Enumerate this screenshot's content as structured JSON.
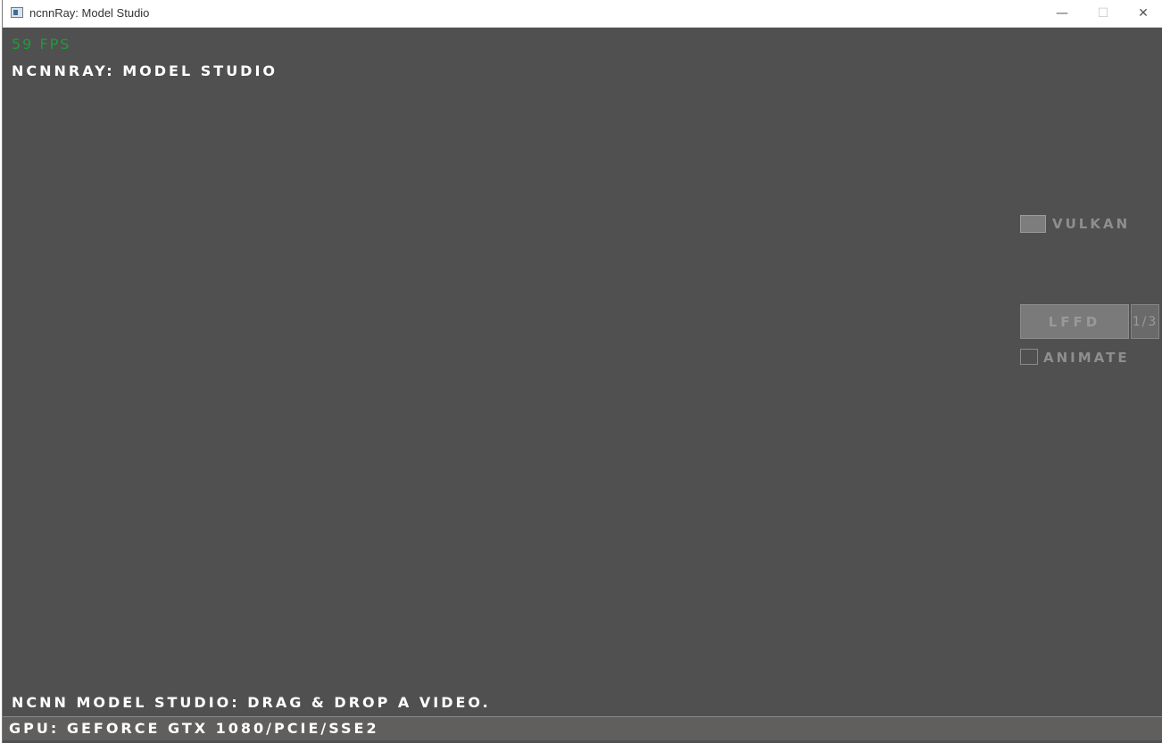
{
  "window": {
    "title": "ncnnRay: Model Studio",
    "minimize_glyph": "—",
    "maximize_glyph": "☐",
    "close_glyph": "✕"
  },
  "hud": {
    "fps": "59 FPS",
    "heading": "ncnnRay: Model Studio"
  },
  "controls": {
    "vulkan_label": "Vulkan",
    "vulkan_checked": true,
    "model_name": "LFFD",
    "model_counter": "1/3",
    "animate_label": "Animate",
    "animate_checked": false
  },
  "status": {
    "message": "NCNN Model Studio: Drag & Drop a video.",
    "gpu": "GPU: GeForce GTX 1080/PCIe/SSE2"
  },
  "colors": {
    "background": "#505050",
    "fps_text": "#1f9a3a",
    "status_bar": "#615e5e"
  }
}
